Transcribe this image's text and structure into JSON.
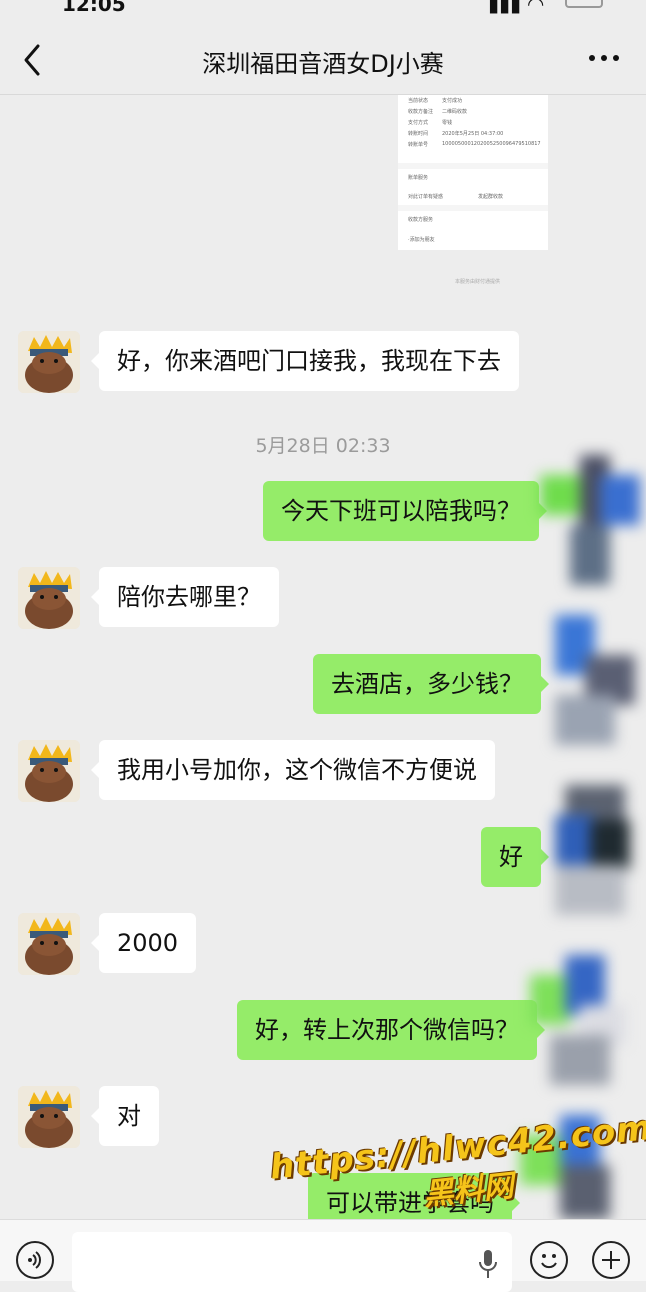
{
  "status_bar": {
    "time": "12:05",
    "signal": "▮▮▮ ◠"
  },
  "nav": {
    "title": "深圳福田音酒女DJ小赛"
  },
  "shared_screenshot": {
    "rows": [
      {
        "label": "当前状态",
        "value": "支付成功"
      },
      {
        "label": "收款方备注",
        "value": "二维码收款"
      },
      {
        "label": "支付方式",
        "value": "零钱"
      },
      {
        "label": "转账时间",
        "value": "2020年5月25日 04:37:00"
      },
      {
        "label": "转账单号",
        "value": "1000050001202005250096479510817"
      }
    ],
    "section2_title": "账单服务",
    "section2_items": [
      "对此订单有疑惑",
      "发起群收款"
    ],
    "section3_title": "收款方服务",
    "section3_item": "·添加为朋友",
    "footer": "本服务由财付通提供"
  },
  "messages": {
    "m1": "好，你来酒吧门口接我，我现在下去",
    "timestamp": "5月28日 02:33",
    "m2": "今天下班可以陪我吗？",
    "m3": "陪你去哪里？",
    "m4": "去酒店，多少钱？",
    "m5": "我用小号加你，这个微信不方便说",
    "m6": "好",
    "m7": "2000",
    "m8": "好，转上次那个微信吗？",
    "m9": "对",
    "m10": "可以带进学套吗"
  },
  "watermark": {
    "url": "https://hlwc42.com",
    "name": "黑料网"
  },
  "colors": {
    "outgoing_bubble": "#95ec69",
    "incoming_bubble": "#ffffff",
    "background": "#ededed",
    "watermark": "#f5c41a"
  }
}
